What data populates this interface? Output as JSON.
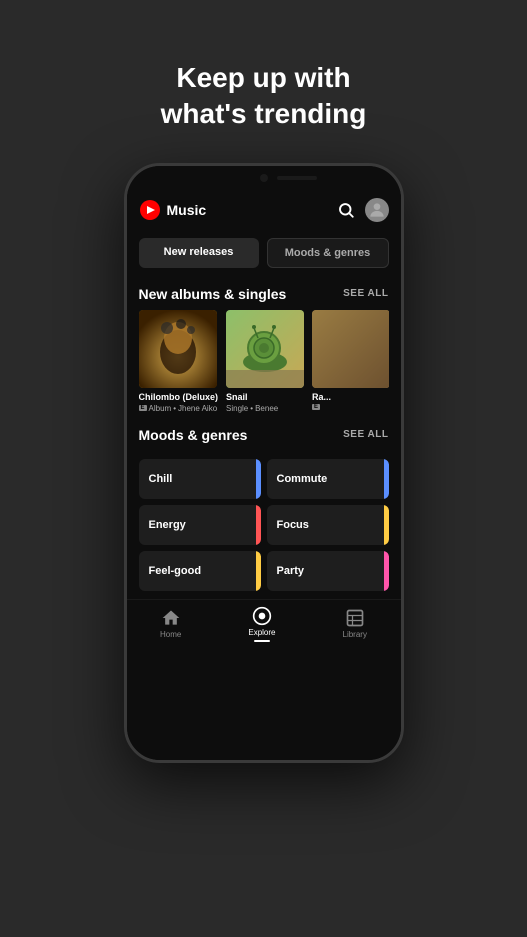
{
  "headline": {
    "line1": "Keep up with",
    "line2": "what's trending"
  },
  "app": {
    "title": "Music",
    "tabs": [
      {
        "label": "New releases",
        "active": true
      },
      {
        "label": "Moods & genres",
        "active": false
      }
    ]
  },
  "new_albums": {
    "section_title": "New albums & singles",
    "see_all": "SEE ALL",
    "albums": [
      {
        "name": "Chilombo (Deluxe)",
        "type": "Album",
        "artist": "Jhene Aiko",
        "explicit": true
      },
      {
        "name": "Snail",
        "type": "Single",
        "artist": "Benee",
        "explicit": false
      },
      {
        "name": "Ra...",
        "type": "",
        "artist": "",
        "explicit": true
      }
    ]
  },
  "moods": {
    "section_title": "Moods & genres",
    "see_all": "SEE ALL",
    "items": [
      {
        "label": "Chill",
        "color": "#5b8fff"
      },
      {
        "label": "Commute",
        "color": "#5b8fff"
      },
      {
        "label": "Energy",
        "color": "#ff5555"
      },
      {
        "label": "Focus",
        "color": "#ffcc44"
      },
      {
        "label": "Feel-good",
        "color": "#ffcc44"
      },
      {
        "label": "Party",
        "color": "#ff55aa"
      }
    ]
  },
  "bottom_nav": {
    "items": [
      {
        "label": "Home",
        "icon": "⌂",
        "active": false
      },
      {
        "label": "Explore",
        "icon": "◎",
        "active": true
      },
      {
        "label": "Library",
        "icon": "⊟",
        "active": false
      }
    ]
  }
}
